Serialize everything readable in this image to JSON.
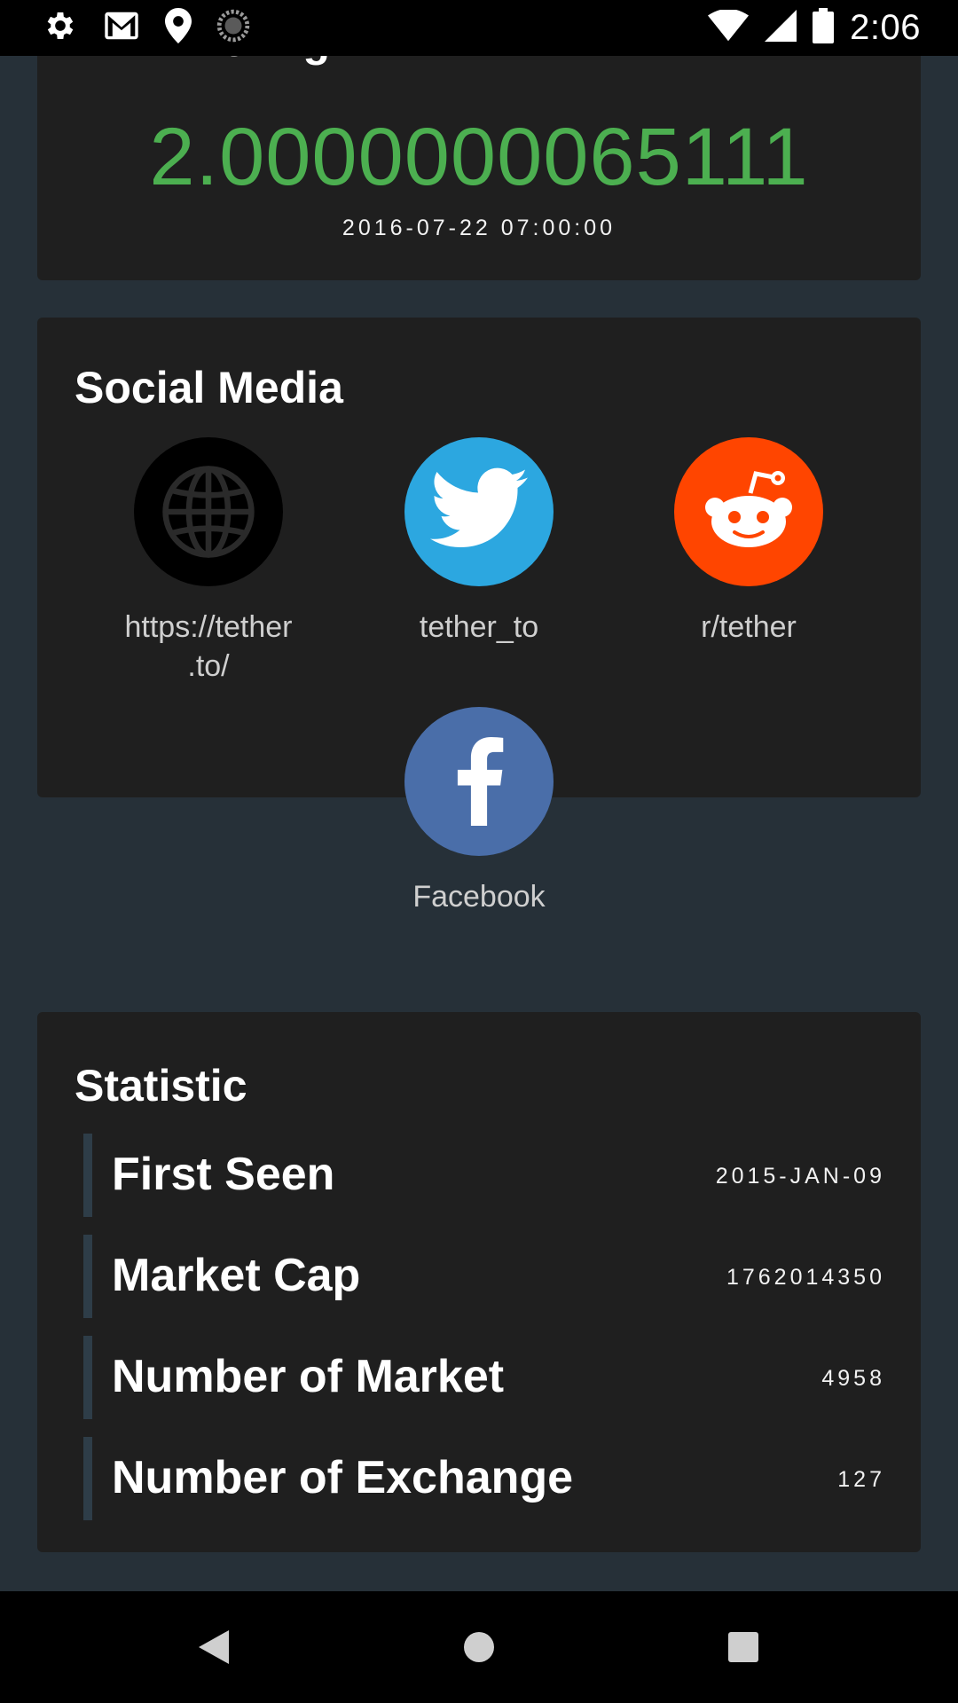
{
  "status_bar": {
    "time": "2:06",
    "icons": [
      "settings-icon",
      "gmail-icon",
      "location-icon",
      "sync-icon",
      "wifi-icon",
      "signal-icon",
      "battery-icon"
    ]
  },
  "all_time_high": {
    "title": "All Time High",
    "value": "2.0000000065111",
    "date": "2016-07-22 07:00:00",
    "value_color": "#4caf50"
  },
  "social_media": {
    "title": "Social Media",
    "items": [
      {
        "label": "https://tether\n.to/",
        "icon": "globe-icon",
        "color": "#000000"
      },
      {
        "label": "tether_to",
        "icon": "twitter-icon",
        "color": "#2ca7e0"
      },
      {
        "label": "r/tether",
        "icon": "reddit-icon",
        "color": "#ff4500"
      },
      {
        "label": "Facebook",
        "icon": "facebook-icon",
        "color": "#4a6ea9"
      }
    ]
  },
  "statistic": {
    "title": "Statistic",
    "rows": [
      {
        "label": "First Seen",
        "value": "2015-JAN-09"
      },
      {
        "label": "Market Cap",
        "value": "1762014350"
      },
      {
        "label": "Number of Market",
        "value": "4958"
      },
      {
        "label": "Number of Exchange",
        "value": "127"
      }
    ]
  },
  "nav_bar": {
    "buttons": [
      "back-icon",
      "home-icon",
      "recents-icon"
    ]
  }
}
